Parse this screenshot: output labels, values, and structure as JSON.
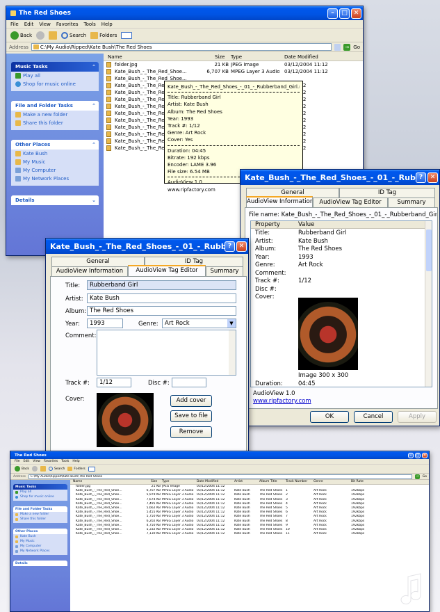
{
  "explorer_top": {
    "title": "The Red Shoes",
    "menu": [
      "File",
      "Edit",
      "View",
      "Favorites",
      "Tools",
      "Help"
    ],
    "toolbar": {
      "back": "Back",
      "search": "Search",
      "folders": "Folders"
    },
    "address_label": "Address",
    "address": "C:\\My Audio\\Ripped\\Kate Bush\\The Red Shoes",
    "go": "Go",
    "tasks": {
      "music_tasks": {
        "title": "Music Tasks",
        "items": [
          "Play all",
          "Shop for music online"
        ]
      },
      "file_tasks": {
        "title": "File and Folder Tasks",
        "items": [
          "Make a new folder",
          "Share this folder"
        ]
      },
      "other_places": {
        "title": "Other Places",
        "items": [
          "Kate Bush",
          "My Music",
          "My Computer",
          "My Network Places"
        ]
      },
      "details": {
        "title": "Details"
      }
    },
    "columns": [
      "Name",
      "Size",
      "Type",
      "Date Modified"
    ],
    "files": [
      {
        "name": "folder.jpg",
        "size": "21 KB",
        "type": "JPEG Image",
        "date": "03/12/2004 11:12"
      },
      {
        "name": "Kate_Bush_-_The_Red_Shoe...",
        "size": "6,707 KB",
        "type": "MPEG Layer 3 Audio",
        "date": "03/12/2004 11:12"
      },
      {
        "name": "Kate_Bush_-_The_Red_Shoe...",
        "size": "",
        "type": "",
        "date": ""
      },
      {
        "name": "Kate_Bush_-_The_Red_Shoe...",
        "size": "",
        "type": "",
        "date": "04 11:12"
      },
      {
        "name": "Kate_Bush_-_The_Red_Shoe...",
        "size": "",
        "type": "",
        "date": "04 11:12"
      },
      {
        "name": "Kate_Bush_-_The_Red_Shoe...",
        "size": "",
        "type": "",
        "date": "04 11:12"
      },
      {
        "name": "Kate_Bush_-_The_Red_Shoe...",
        "size": "",
        "type": "",
        "date": "04 11:12"
      },
      {
        "name": "Kate_Bush_-_The_Red_Shoe...",
        "size": "",
        "type": "",
        "date": "04 11:12"
      },
      {
        "name": "Kate_Bush_-_The_Red_Shoe...",
        "size": "",
        "type": "",
        "date": "04 11:12"
      },
      {
        "name": "Kate_Bush_-_The_Red_Shoe...",
        "size": "",
        "type": "",
        "date": "04 11:12"
      },
      {
        "name": "Kate_Bush_-_The_Red_Shoe...",
        "size": "",
        "type": "",
        "date": "04 11:12"
      },
      {
        "name": "Kate_Bush_-_The_Red_Shoe...",
        "size": "",
        "type": "",
        "date": "04 11:12"
      },
      {
        "name": "Kate_Bush_-_The_Red_Shoe...",
        "size": "",
        "type": "",
        "date": "04 11:12"
      }
    ]
  },
  "tooltip": {
    "filename": "Kate_Bush_-_The_Red_Shoes_-_01_-_Rubberband_Girl.mp3",
    "lines": [
      "Title: Rubberband Girl",
      "Artist: Kate Bush",
      "Album: The Red Shoes",
      "Year: 1993",
      "Track #: 1/12",
      "Genre: Art Rock",
      "Cover: Yes"
    ],
    "tech": [
      "Duration: 04:45",
      "Bitrate: 192 kbps",
      "Encoder: LAME 3.96",
      "File size: 6.54 MB"
    ],
    "footer": [
      "AudioView 1.0",
      "www.ripfactory.com"
    ]
  },
  "dialog_right": {
    "title": "Kate_Bush_-_The_Red_Shoes_-_01_-_Rubberba...",
    "tabs_row1": [
      "General",
      "ID Tag"
    ],
    "tabs_row2": [
      "AudioView Information",
      "AudioView Tag Editor",
      "Summary"
    ],
    "filename_label": "File name: Kate_Bush_-_The_Red_Shoes_-_01_-_Rubberband_Girl.mp3",
    "grid_headers": [
      "Property",
      "Value"
    ],
    "props": [
      {
        "k": "Title:",
        "v": "Rubberband Girl"
      },
      {
        "k": "Artist:",
        "v": "Kate Bush"
      },
      {
        "k": "Album:",
        "v": "The Red Shoes"
      },
      {
        "k": "Year:",
        "v": "1993"
      },
      {
        "k": "Genre:",
        "v": "Art Rock"
      },
      {
        "k": "Comment:",
        "v": ""
      },
      {
        "k": "Track #:",
        "v": "1/12"
      },
      {
        "k": "Disc #:",
        "v": ""
      },
      {
        "k": "Cover:",
        "v": ""
      }
    ],
    "image_caption": "Image 300 x 300",
    "duration_label": "Duration:",
    "duration": "04:45",
    "footer1": "AudioView 1.0",
    "footer2": "www.ripfactory.com",
    "ok": "OK",
    "cancel": "Cancel",
    "apply": "Apply"
  },
  "dialog_left": {
    "title": "Kate_Bush_-_The_Red_Shoes_-_01_-_Rubberba...",
    "tabs_row1": [
      "General",
      "ID Tag"
    ],
    "tabs_row2": [
      "AudioView Information",
      "AudioView Tag Editor",
      "Summary"
    ],
    "title_label": "Title:",
    "title_value": "Rubberband Girl",
    "artist_label": "Artist:",
    "artist_value": "Kate Bush",
    "album_label": "Album:",
    "album_value": "The Red Shoes",
    "year_label": "Year:",
    "year_value": "1993",
    "genre_label": "Genre:",
    "genre_value": "Art Rock",
    "comment_label": "Comment:",
    "track_label": "Track #:",
    "track_value": "1/12",
    "disc_label": "Disc #:",
    "disc_value": "",
    "cover_label": "Cover:",
    "add_cover": "Add cover",
    "save_to_file": "Save to file",
    "remove": "Remove"
  },
  "explorer_bottom": {
    "title": "The Red Shoes",
    "menu": [
      "File",
      "Edit",
      "View",
      "Favorites",
      "Tools",
      "Help"
    ],
    "toolbar": {
      "back": "Back",
      "search": "Search",
      "folders": "Folders"
    },
    "address_label": "Address",
    "address": "C:\\My Audio\\Ripped\\Kate Bush\\The Red Shoes",
    "go": "Go",
    "tasks": {
      "music_tasks": {
        "title": "Music Tasks",
        "items": [
          "Play all",
          "Shop for music online"
        ]
      },
      "file_tasks": {
        "title": "File and Folder Tasks",
        "items": [
          "Make a new folder",
          "Share this folder"
        ]
      },
      "other_places": {
        "title": "Other Places",
        "items": [
          "Kate Bush",
          "My Music",
          "My Computer",
          "My Network Places"
        ]
      },
      "details": {
        "title": "Details"
      }
    },
    "columns": [
      "Name",
      "Size",
      "Type",
      "Date Modified",
      "Artist",
      "Album Title",
      "Track Number",
      "Genre",
      "Bit Rate"
    ],
    "files": [
      {
        "name": "folder.jpg",
        "size": "21 KB",
        "type": "JPEG Image",
        "date": "03/12/2004 11:12",
        "artist": "",
        "album": "",
        "track": "",
        "genre": "",
        "bitrate": ""
      },
      {
        "name": "Kate_Bush_-_The_Red_Shoe...",
        "size": "6,707 KB",
        "type": "MPEG Layer 3 Audio",
        "date": "03/12/2004 11:12",
        "artist": "Kate Bush",
        "album": "The Red Shoes",
        "track": "1",
        "genre": "Art Rock",
        "bitrate": "192kbps"
      },
      {
        "name": "Kate_Bush_-_The_Red_Shoe...",
        "size": "5,979 KB",
        "type": "MPEG Layer 3 Audio",
        "date": "03/12/2004 11:12",
        "artist": "Kate Bush",
        "album": "The Red Shoes",
        "track": "2",
        "genre": "Art Rock",
        "bitrate": "192kbps"
      },
      {
        "name": "Kate_Bush_-_The_Red_Shoe...",
        "size": "7,674 KB",
        "type": "MPEG Layer 3 Audio",
        "date": "03/12/2004 11:12",
        "artist": "Kate Bush",
        "album": "The Red Shoes",
        "track": "3",
        "genre": "Art Rock",
        "bitrate": "192kbps"
      },
      {
        "name": "Kate_Bush_-_The_Red_Shoe...",
        "size": "7,495 KB",
        "type": "MPEG Layer 3 Audio",
        "date": "03/12/2004 11:12",
        "artist": "Kate Bush",
        "album": "The Red Shoes",
        "track": "4",
        "genre": "Art Rock",
        "bitrate": "192kbps"
      },
      {
        "name": "Kate_Bush_-_The_Red_Shoe...",
        "size": "5,662 KB",
        "type": "MPEG Layer 3 Audio",
        "date": "03/12/2004 11:12",
        "artist": "Kate Bush",
        "album": "The Red Shoes",
        "track": "5",
        "genre": "Art Rock",
        "bitrate": "192kbps"
      },
      {
        "name": "Kate_Bush_-_The_Red_Shoe...",
        "size": "5,455 KB",
        "type": "MPEG Layer 3 Audio",
        "date": "03/12/2004 11:12",
        "artist": "Kate Bush",
        "album": "The Red Shoes",
        "track": "6",
        "genre": "Art Rock",
        "bitrate": "192kbps"
      },
      {
        "name": "Kate_Bush_-_The_Red_Shoe...",
        "size": "5,750 KB",
        "type": "MPEG Layer 3 Audio",
        "date": "03/12/2004 11:12",
        "artist": "Kate Bush",
        "album": "The Red Shoes",
        "track": "7",
        "genre": "Art Rock",
        "bitrate": "192kbps"
      },
      {
        "name": "Kate_Bush_-_The_Red_Shoe...",
        "size": "6,202 KB",
        "type": "MPEG Layer 3 Audio",
        "date": "03/12/2004 11:12",
        "artist": "Kate Bush",
        "album": "The Red Shoes",
        "track": "8",
        "genre": "Art Rock",
        "bitrate": "192kbps"
      },
      {
        "name": "Kate_Bush_-_The_Red_Shoe...",
        "size": "4,750 KB",
        "type": "MPEG Layer 3 Audio",
        "date": "03/12/2004 11:12",
        "artist": "Kate Bush",
        "album": "The Red Shoes",
        "track": "9",
        "genre": "Art Rock",
        "bitrate": "192kbps"
      },
      {
        "name": "Kate_Bush_-_The_Red_Shoe...",
        "size": "5,332 KB",
        "type": "MPEG Layer 3 Audio",
        "date": "03/12/2004 11:12",
        "artist": "Kate Bush",
        "album": "The Red Shoes",
        "track": "10",
        "genre": "Art Rock",
        "bitrate": "192kbps"
      },
      {
        "name": "Kate_Bush_-_The_Red_Shoe...",
        "size": "7,130 KB",
        "type": "MPEG Layer 3 Audio",
        "date": "03/12/2004 11:12",
        "artist": "Kate Bush",
        "album": "The Red Shoes",
        "track": "11",
        "genre": "Art Rock",
        "bitrate": "192kbps"
      }
    ]
  },
  "colors": {
    "xp_blue": "#0054e3",
    "task_blue": "#6375d6",
    "tooltip_bg": "#ffffe1",
    "tab_accent": "#f5a825"
  }
}
